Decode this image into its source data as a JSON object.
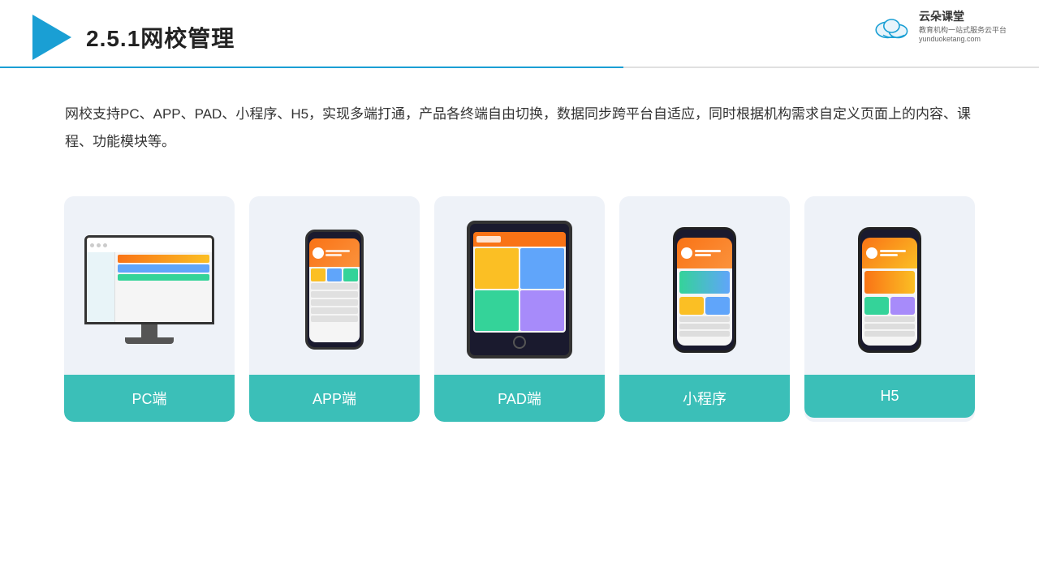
{
  "header": {
    "title": "2.5.1网校管理",
    "brand": {
      "name": "云朵课堂",
      "url": "yunduoketang.com",
      "slogan": "教育机构一站\n式服务云平台"
    }
  },
  "description": "网校支持PC、APP、PAD、小程序、H5，实现多端打通，产品各终端自由切换，数据同步跨平台自适应，同时根据机构需求自定义页面上的内容、课程、功能模块等。",
  "cards": [
    {
      "id": "pc",
      "label": "PC端"
    },
    {
      "id": "app",
      "label": "APP端"
    },
    {
      "id": "pad",
      "label": "PAD端"
    },
    {
      "id": "mini-program",
      "label": "小程序"
    },
    {
      "id": "h5",
      "label": "H5"
    }
  ],
  "colors": {
    "accent": "#1a9fd4",
    "card_bg": "#eef2f8",
    "label_bg": "#3bbfb8",
    "label_text": "#ffffff"
  }
}
